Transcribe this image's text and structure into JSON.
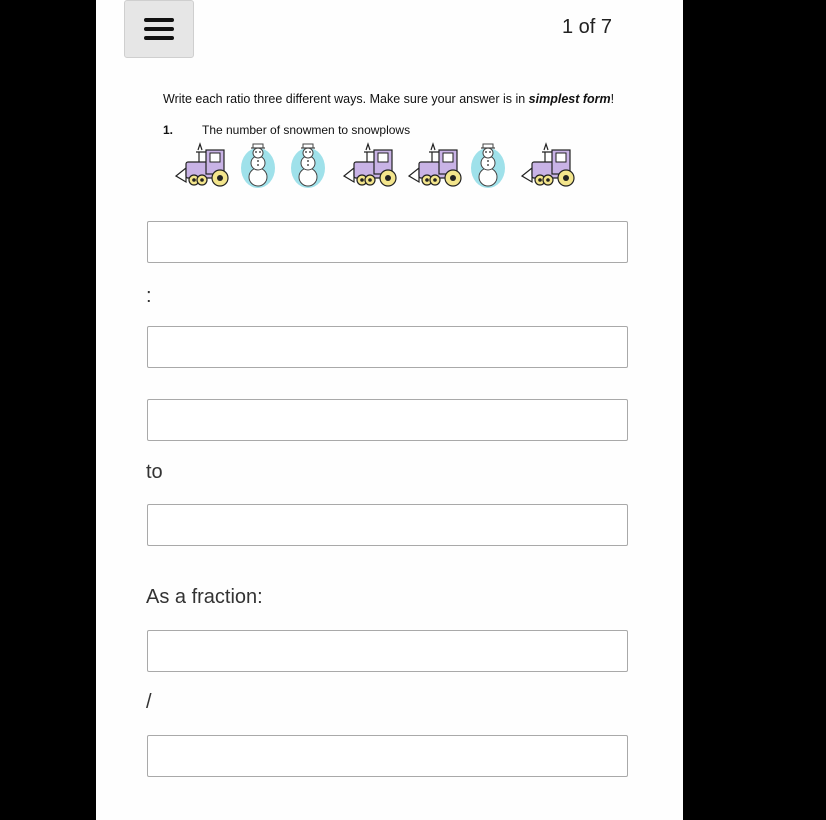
{
  "header": {
    "page_indicator": "1 of 7",
    "menu_icon": "hamburger-menu-icon"
  },
  "worksheet": {
    "instructions_prefix": "Write each ratio three different ways.  Make sure your answer is in ",
    "instructions_emphasis": "simplest form",
    "instructions_suffix": "!",
    "question_number": "1.",
    "question_text": "The number of snowmen to snowplows",
    "pictures": [
      "snowplow",
      "snowman",
      "snowman",
      "snowplow",
      "snowplow",
      "snowman",
      "snowplow"
    ]
  },
  "answers": {
    "colon_label": ":",
    "to_label": "to",
    "fraction_label": "As a fraction:",
    "slash_label": "/",
    "fields": [
      {
        "value": "",
        "placeholder": ""
      },
      {
        "value": "",
        "placeholder": ""
      },
      {
        "value": "",
        "placeholder": ""
      },
      {
        "value": "",
        "placeholder": ""
      },
      {
        "value": "",
        "placeholder": ""
      },
      {
        "value": "",
        "placeholder": ""
      }
    ]
  },
  "colors": {
    "plow_body": "#c9b3e6",
    "snowman_glow": "#9fe1ea",
    "wheel": "#f3e58c"
  }
}
